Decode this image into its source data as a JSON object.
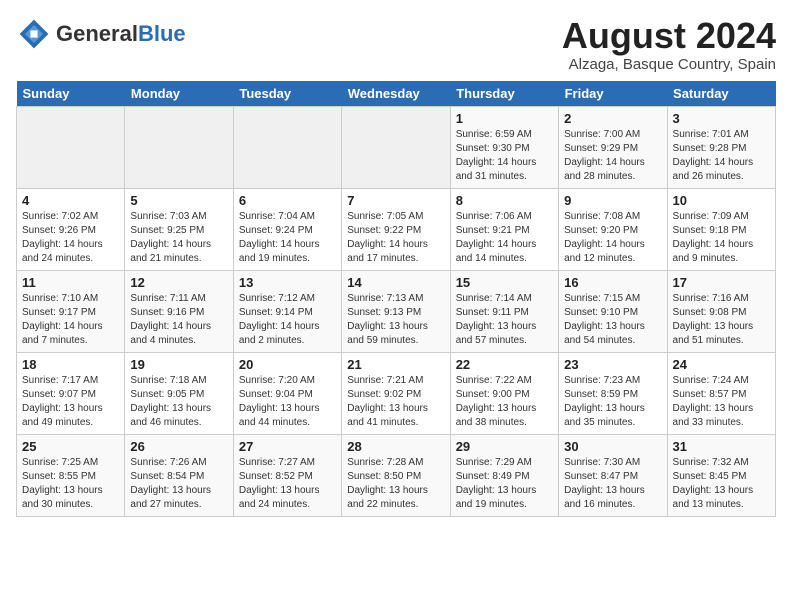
{
  "header": {
    "logo_general": "General",
    "logo_blue": "Blue",
    "month_title": "August 2024",
    "location": "Alzaga, Basque Country, Spain"
  },
  "weekdays": [
    "Sunday",
    "Monday",
    "Tuesday",
    "Wednesday",
    "Thursday",
    "Friday",
    "Saturday"
  ],
  "weeks": [
    [
      {
        "day": "",
        "info": ""
      },
      {
        "day": "",
        "info": ""
      },
      {
        "day": "",
        "info": ""
      },
      {
        "day": "",
        "info": ""
      },
      {
        "day": "1",
        "info": "Sunrise: 6:59 AM\nSunset: 9:30 PM\nDaylight: 14 hours\nand 31 minutes."
      },
      {
        "day": "2",
        "info": "Sunrise: 7:00 AM\nSunset: 9:29 PM\nDaylight: 14 hours\nand 28 minutes."
      },
      {
        "day": "3",
        "info": "Sunrise: 7:01 AM\nSunset: 9:28 PM\nDaylight: 14 hours\nand 26 minutes."
      }
    ],
    [
      {
        "day": "4",
        "info": "Sunrise: 7:02 AM\nSunset: 9:26 PM\nDaylight: 14 hours\nand 24 minutes."
      },
      {
        "day": "5",
        "info": "Sunrise: 7:03 AM\nSunset: 9:25 PM\nDaylight: 14 hours\nand 21 minutes."
      },
      {
        "day": "6",
        "info": "Sunrise: 7:04 AM\nSunset: 9:24 PM\nDaylight: 14 hours\nand 19 minutes."
      },
      {
        "day": "7",
        "info": "Sunrise: 7:05 AM\nSunset: 9:22 PM\nDaylight: 14 hours\nand 17 minutes."
      },
      {
        "day": "8",
        "info": "Sunrise: 7:06 AM\nSunset: 9:21 PM\nDaylight: 14 hours\nand 14 minutes."
      },
      {
        "day": "9",
        "info": "Sunrise: 7:08 AM\nSunset: 9:20 PM\nDaylight: 14 hours\nand 12 minutes."
      },
      {
        "day": "10",
        "info": "Sunrise: 7:09 AM\nSunset: 9:18 PM\nDaylight: 14 hours\nand 9 minutes."
      }
    ],
    [
      {
        "day": "11",
        "info": "Sunrise: 7:10 AM\nSunset: 9:17 PM\nDaylight: 14 hours\nand 7 minutes."
      },
      {
        "day": "12",
        "info": "Sunrise: 7:11 AM\nSunset: 9:16 PM\nDaylight: 14 hours\nand 4 minutes."
      },
      {
        "day": "13",
        "info": "Sunrise: 7:12 AM\nSunset: 9:14 PM\nDaylight: 14 hours\nand 2 minutes."
      },
      {
        "day": "14",
        "info": "Sunrise: 7:13 AM\nSunset: 9:13 PM\nDaylight: 13 hours\nand 59 minutes."
      },
      {
        "day": "15",
        "info": "Sunrise: 7:14 AM\nSunset: 9:11 PM\nDaylight: 13 hours\nand 57 minutes."
      },
      {
        "day": "16",
        "info": "Sunrise: 7:15 AM\nSunset: 9:10 PM\nDaylight: 13 hours\nand 54 minutes."
      },
      {
        "day": "17",
        "info": "Sunrise: 7:16 AM\nSunset: 9:08 PM\nDaylight: 13 hours\nand 51 minutes."
      }
    ],
    [
      {
        "day": "18",
        "info": "Sunrise: 7:17 AM\nSunset: 9:07 PM\nDaylight: 13 hours\nand 49 minutes."
      },
      {
        "day": "19",
        "info": "Sunrise: 7:18 AM\nSunset: 9:05 PM\nDaylight: 13 hours\nand 46 minutes."
      },
      {
        "day": "20",
        "info": "Sunrise: 7:20 AM\nSunset: 9:04 PM\nDaylight: 13 hours\nand 44 minutes."
      },
      {
        "day": "21",
        "info": "Sunrise: 7:21 AM\nSunset: 9:02 PM\nDaylight: 13 hours\nand 41 minutes."
      },
      {
        "day": "22",
        "info": "Sunrise: 7:22 AM\nSunset: 9:00 PM\nDaylight: 13 hours\nand 38 minutes."
      },
      {
        "day": "23",
        "info": "Sunrise: 7:23 AM\nSunset: 8:59 PM\nDaylight: 13 hours\nand 35 minutes."
      },
      {
        "day": "24",
        "info": "Sunrise: 7:24 AM\nSunset: 8:57 PM\nDaylight: 13 hours\nand 33 minutes."
      }
    ],
    [
      {
        "day": "25",
        "info": "Sunrise: 7:25 AM\nSunset: 8:55 PM\nDaylight: 13 hours\nand 30 minutes."
      },
      {
        "day": "26",
        "info": "Sunrise: 7:26 AM\nSunset: 8:54 PM\nDaylight: 13 hours\nand 27 minutes."
      },
      {
        "day": "27",
        "info": "Sunrise: 7:27 AM\nSunset: 8:52 PM\nDaylight: 13 hours\nand 24 minutes."
      },
      {
        "day": "28",
        "info": "Sunrise: 7:28 AM\nSunset: 8:50 PM\nDaylight: 13 hours\nand 22 minutes."
      },
      {
        "day": "29",
        "info": "Sunrise: 7:29 AM\nSunset: 8:49 PM\nDaylight: 13 hours\nand 19 minutes."
      },
      {
        "day": "30",
        "info": "Sunrise: 7:30 AM\nSunset: 8:47 PM\nDaylight: 13 hours\nand 16 minutes."
      },
      {
        "day": "31",
        "info": "Sunrise: 7:32 AM\nSunset: 8:45 PM\nDaylight: 13 hours\nand 13 minutes."
      }
    ]
  ]
}
